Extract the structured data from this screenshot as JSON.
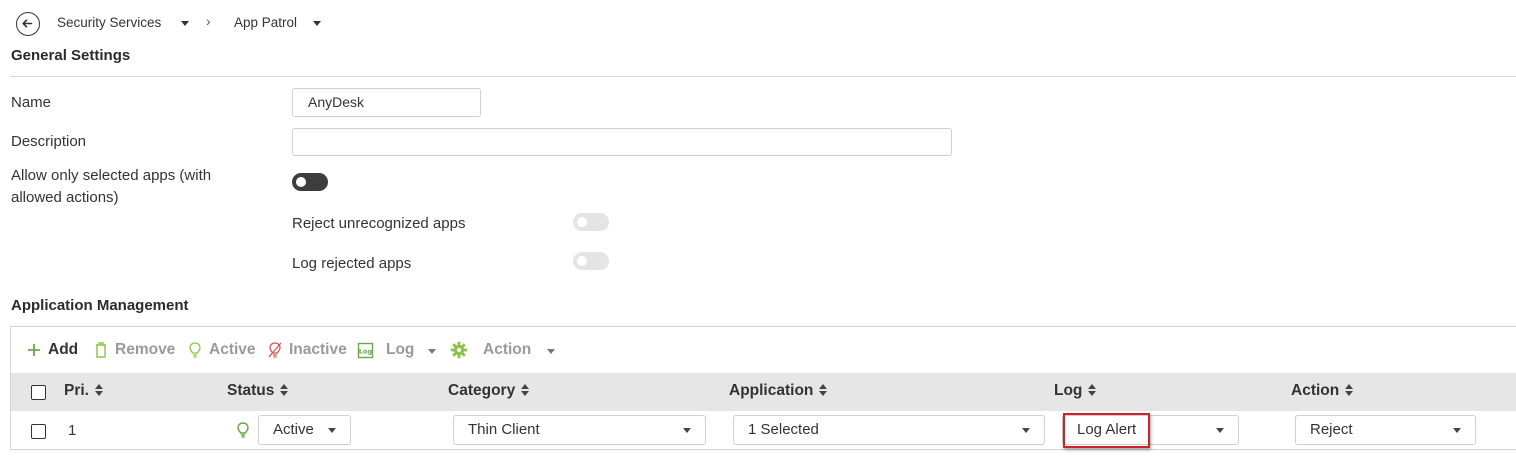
{
  "breadcrumb": {
    "items": [
      {
        "label": "Security Services"
      },
      {
        "label": "App Patrol"
      }
    ],
    "separator": "›"
  },
  "general": {
    "title": "General Settings",
    "name_label": "Name",
    "name_value": "AnyDesk",
    "description_label": "Description",
    "description_value": "",
    "allow_only_label": "Allow only selected apps (with allowed actions)",
    "allow_only_on": true,
    "reject_unrecognized_label": "Reject unrecognized apps",
    "reject_unrecognized_on": false,
    "log_rejected_label": "Log rejected apps",
    "log_rejected_on": false
  },
  "app_mgmt": {
    "title": "Application Management",
    "toolbar": {
      "add": "Add",
      "remove": "Remove",
      "active": "Active",
      "inactive": "Inactive",
      "log": "Log",
      "action": "Action"
    },
    "columns": [
      "Pri.",
      "Status",
      "Category",
      "Application",
      "Log",
      "Action"
    ],
    "rows": [
      {
        "pri": "1",
        "status": "Active",
        "category": "Thin Client",
        "application": "1 Selected",
        "log": "Log Alert",
        "action": "Reject"
      }
    ]
  },
  "colors": {
    "accent_green": "#6aa84f",
    "inactive_red": "#d9534f",
    "highlight_red": "#d0202a"
  },
  "icons": [
    "back-arrow-icon",
    "plus-icon",
    "trash-icon",
    "bulb-icon",
    "bulb-off-icon",
    "log-icon",
    "gear-icon"
  ]
}
